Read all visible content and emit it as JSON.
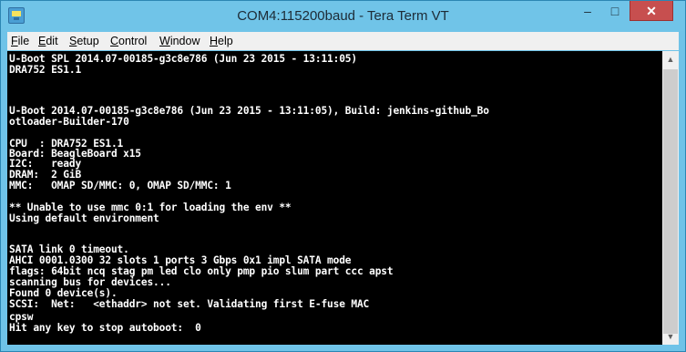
{
  "window": {
    "title": "COM4:115200baud - Tera Term VT",
    "controls": {
      "minimize": "–",
      "maximize": "□",
      "close": "✕"
    }
  },
  "menu": [
    {
      "first": "F",
      "rest": "ile"
    },
    {
      "first": "E",
      "rest": "dit"
    },
    {
      "first": "S",
      "rest": "etup"
    },
    {
      "first": "C",
      "rest": "ontrol"
    },
    {
      "first": "W",
      "rest": "indow"
    },
    {
      "first": "H",
      "rest": "elp"
    }
  ],
  "terminal": {
    "lines": [
      "U-Boot SPL 2014.07-00185-g3c8e786 (Jun 23 2015 - 13:11:05)",
      "DRA752 ES1.1",
      "",
      "",
      "U-Boot 2014.07-00185-g3c8e786 (Jun 23 2015 - 13:11:05), Build: jenkins-github_Bo",
      "otloader-Builder-170",
      "",
      "CPU  : DRA752 ES1.1",
      "Board: BeagleBoard x15",
      "I2C:   ready",
      "DRAM:  2 GiB",
      "MMC:   OMAP SD/MMC: 0, OMAP SD/MMC: 1",
      "",
      "** Unable to use mmc 0:1 for loading the env **",
      "Using default environment",
      "",
      "SATA link 0 timeout.",
      "AHCI 0001.0300 32 slots 1 ports 3 Gbps 0x1 impl SATA mode",
      "flags: 64bit ncq stag pm led clo only pmp pio slum part ccc apst",
      "scanning bus for devices...",
      "Found 0 device(s).",
      "SCSI:  Net:   <ethaddr> not set. Validating first E-fuse MAC",
      "cpsw",
      "Hit any key to stop autoboot:  0"
    ]
  },
  "scrollbar": {
    "up_arrow": "▲",
    "down_arrow": "▼"
  },
  "colors": {
    "titlebar": "#70c4e8",
    "close_button": "#c74f4f",
    "terminal_bg": "#000000",
    "terminal_fg": "#ffffff"
  }
}
